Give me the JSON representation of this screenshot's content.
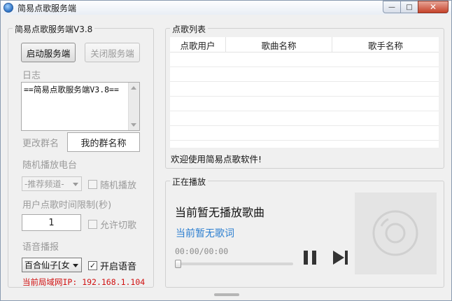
{
  "window": {
    "title": "简易点歌服务端",
    "minimize_glyph": "—",
    "maximize_glyph": "□",
    "close_glyph": "✕"
  },
  "server_panel": {
    "group_title": "简易点歌服务端V3.8",
    "start_button": "启动服务端",
    "stop_button": "关闭服务端",
    "log_label": "日志",
    "log_text": "==简易点歌服务端V3.8==",
    "group_name_label": "更改群名",
    "group_name_value": "我的群名称",
    "radio_label": "随机播放电台",
    "channel_select": "-推荐频道-",
    "random_play_label": "随机播放",
    "time_limit_label": "用户点歌时间限制(秒)",
    "time_limit_value": "1",
    "allow_skip_label": "允许切歌",
    "voice_label": "语音播报",
    "voice_select": "百合仙子[女",
    "enable_voice_label": "开启语音",
    "enable_voice_checked": "✓",
    "ip_text": "当前局域网IP: 192.168.1.104"
  },
  "song_list": {
    "group_title": "点歌列表",
    "columns": [
      "点歌用户",
      "歌曲名称",
      "歌手名称"
    ],
    "rows": [],
    "welcome_text": "欢迎使用简易点歌软件!"
  },
  "now_playing": {
    "group_title": "正在播放",
    "song_title": "当前暂无播放歌曲",
    "lyric": "当前暂无歌词",
    "time": "00:00/00:00",
    "progress": 0
  },
  "colors": {
    "accent_link": "#2d7fd0",
    "ip_red": "#d01010",
    "disabled_text": "#9a9a9a"
  }
}
